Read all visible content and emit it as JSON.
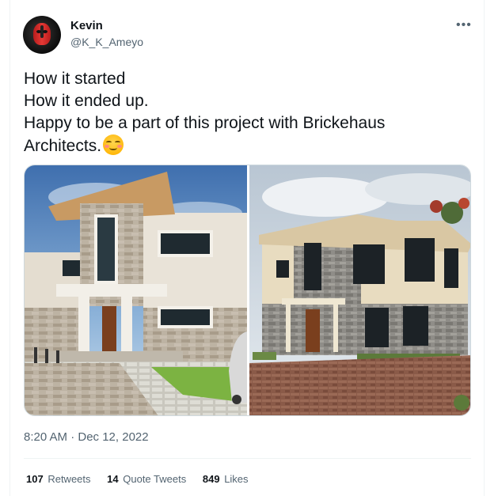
{
  "author": {
    "name": "Kevin",
    "handle": "@K_K_Ameyo"
  },
  "tweet": {
    "lines": [
      "How it started",
      "How it ended up.",
      "Happy to be a part of this project with Brickehaus",
      "Architects."
    ],
    "emoji": "smiling-face-icon",
    "timestamp": "8:20 AM · Dec 12, 2022"
  },
  "media": [
    {
      "description": "render",
      "sky": "#5d8fc4"
    },
    {
      "description": "photo",
      "sky": "#c9d3dc"
    }
  ],
  "stats": {
    "retweets": {
      "count": "107",
      "label": "Retweets"
    },
    "quotes": {
      "count": "14",
      "label": "Quote Tweets"
    },
    "likes": {
      "count": "849",
      "label": "Likes"
    }
  },
  "colors": {
    "text": "#0f1419",
    "secondary": "#536471",
    "border": "#eff3f4"
  }
}
